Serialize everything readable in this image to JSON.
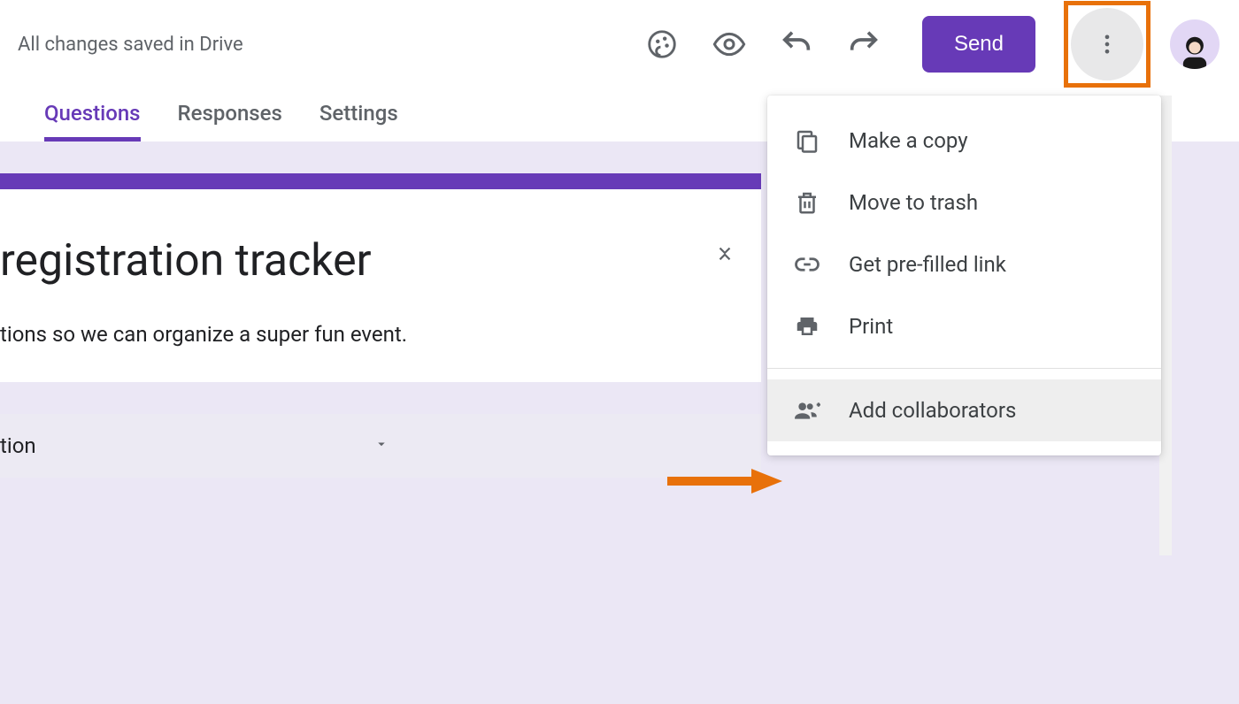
{
  "header": {
    "status": "All changes saved in Drive",
    "send_label": "Send"
  },
  "tabs": {
    "items": [
      {
        "label": "Questions",
        "active": true
      },
      {
        "label": "Responses",
        "active": false
      },
      {
        "label": "Settings",
        "active": false
      }
    ]
  },
  "form": {
    "title_fragment": "registration tracker",
    "description_fragment": "tions so we can organize a super fun event.",
    "question_label_fragment": "tion"
  },
  "menu": {
    "items": [
      {
        "label": "Make a copy",
        "icon": "copy-icon"
      },
      {
        "label": "Move to trash",
        "icon": "trash-icon"
      },
      {
        "label": "Get pre-filled link",
        "icon": "link-icon"
      },
      {
        "label": "Print",
        "icon": "print-icon"
      }
    ],
    "items2": [
      {
        "label": "Add collaborators",
        "icon": "people-add-icon",
        "highlight": true
      }
    ]
  },
  "colors": {
    "accent": "#673ab7",
    "annotation": "#e8710a"
  }
}
